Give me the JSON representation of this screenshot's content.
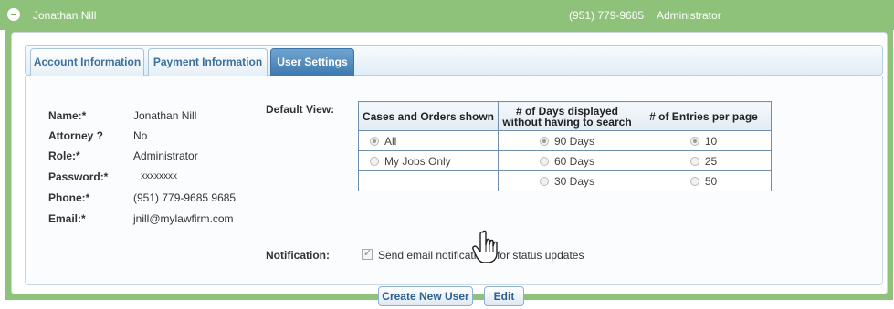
{
  "header": {
    "name": "Jonathan Nill",
    "phone": "(951) 779-9685",
    "role": "Administrator"
  },
  "tabs": [
    {
      "label": "Account Information"
    },
    {
      "label": "Payment Information"
    },
    {
      "label": "User Settings",
      "active": true
    }
  ],
  "profile": {
    "name_label": "Name:*",
    "name_value": "Jonathan Nill",
    "attorney_label": "Attorney ?",
    "attorney_value": "No",
    "role_label": "Role:*",
    "role_value": "Administrator",
    "password_label": "Password:*",
    "password_value": "xxxxxxxx",
    "phone_label": "Phone:*",
    "phone_value": "(951) 779-9685 9685",
    "email_label": "Email:*",
    "email_value": "jnill@mylawfirm.com"
  },
  "default_view": {
    "label": "Default View:",
    "columns": [
      "Cases and Orders shown",
      "# of Days displayed without having to search",
      "# of Entries per page"
    ],
    "cases_options": [
      {
        "label": "All",
        "selected": true
      },
      {
        "label": "My Jobs Only",
        "selected": false
      }
    ],
    "days_options": [
      {
        "label": "90 Days",
        "selected": true
      },
      {
        "label": "60 Days",
        "selected": false
      },
      {
        "label": "30 Days",
        "selected": false
      }
    ],
    "entries_options": [
      {
        "label": "10",
        "selected": true
      },
      {
        "label": "25",
        "selected": false
      },
      {
        "label": "50",
        "selected": false
      }
    ]
  },
  "notification": {
    "label": "Notification:",
    "text": "Send email notifications for status updates",
    "checked": true
  },
  "buttons": {
    "create_label": "Create New User",
    "edit_label": "Edit"
  },
  "colors": {
    "header_green": "#8ec27a",
    "tab_active_blue": "#3d7ab0",
    "link_blue": "#2d5f8f"
  }
}
